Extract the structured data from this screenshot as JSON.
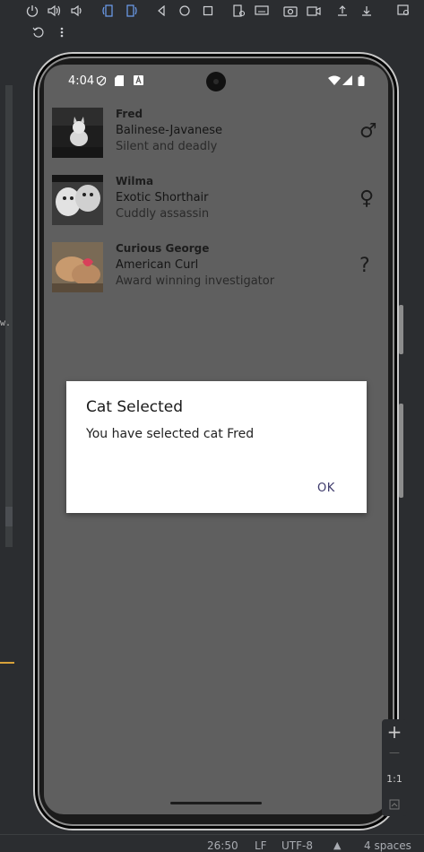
{
  "toolbar": {
    "buttons": [
      "power-icon",
      "volume-up-icon",
      "volume-down-icon",
      "rotate-left-icon",
      "rotate-right-icon",
      "back-icon",
      "home-icon",
      "overview-icon",
      "fold-icon",
      "keyboard-icon",
      "camera-icon",
      "video-icon",
      "upload-icon",
      "download-icon",
      "search-window-icon",
      "snapshot-icon",
      "more-icon"
    ]
  },
  "device": {
    "status_time": "4:04"
  },
  "cats": [
    {
      "name": "Fred",
      "breed": "Balinese-Javanese",
      "description": "Silent and deadly",
      "gender_symbol": "♂"
    },
    {
      "name": "Wilma",
      "breed": "Exotic Shorthair",
      "description": "Cuddly assassin",
      "gender_symbol": "♀"
    },
    {
      "name": "Curious George",
      "breed": "American Curl",
      "description": "Award winning investigator",
      "gender_symbol": "?"
    }
  ],
  "dialog": {
    "title": "Cat Selected",
    "message": "You have selected cat Fred",
    "ok_label": "OK"
  },
  "zoom": {
    "plus": "+",
    "minus": "—",
    "ratio": "1:1"
  },
  "ide_status": {
    "position": "26:50",
    "line_sep": "LF",
    "encoding": "UTF-8",
    "indent": "4 spaces"
  },
  "left_gutter_text": "w."
}
